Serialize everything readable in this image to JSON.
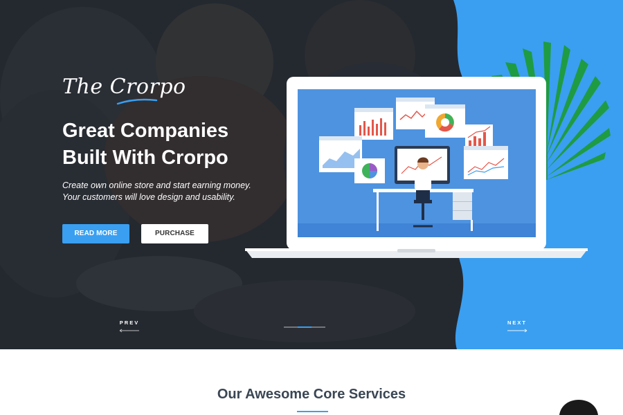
{
  "hero": {
    "brand_name": "The Crorpo",
    "headline_line1": "Great Companies",
    "headline_line2": "Built With Crorpo",
    "subtext": "Create own online store and start earning money. Your customers will love design and usability.",
    "primary_button": "READ MORE",
    "secondary_button": "PURCHASE",
    "prev_label": "PREV",
    "next_label": "NEXT",
    "slide_count": 3,
    "active_slide": 2
  },
  "services": {
    "title": "Our Awesome Core Services"
  },
  "colors": {
    "accent": "#3a9ff0",
    "hero_overlay": "#2b2f36",
    "title_text": "#3a4654"
  }
}
